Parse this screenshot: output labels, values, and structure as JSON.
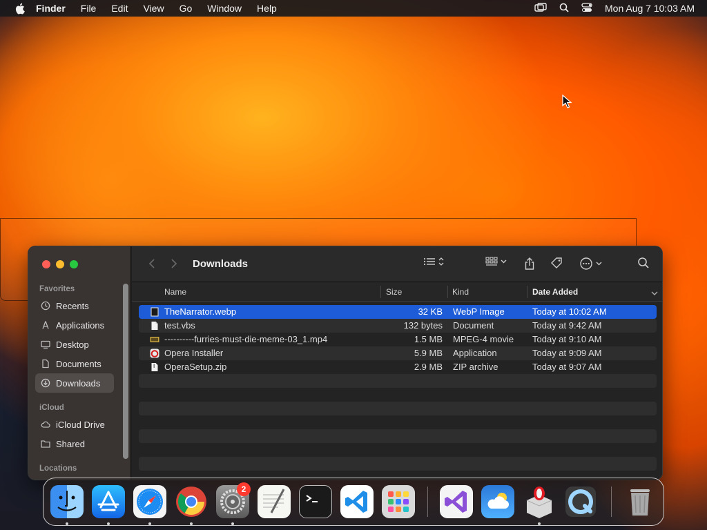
{
  "menubar": {
    "app_name": "Finder",
    "menus": [
      "File",
      "Edit",
      "View",
      "Go",
      "Window",
      "Help"
    ],
    "clock": "Mon Aug 7  10:03 AM",
    "status_icons": [
      "screen-mirroring-icon",
      "spotlight-search-icon",
      "control-center-icon"
    ]
  },
  "finder": {
    "title": "Downloads",
    "sidebar": {
      "favorites_label": "Favorites",
      "favorites": [
        "Recents",
        "Applications",
        "Desktop",
        "Documents",
        "Downloads"
      ],
      "icloud_label": "iCloud",
      "icloud": [
        "iCloud Drive",
        "Shared"
      ],
      "locations_label": "Locations"
    },
    "columns": {
      "name": "Name",
      "size": "Size",
      "kind": "Kind",
      "date_added": "Date Added"
    },
    "files": [
      {
        "name": "TheNarrator.webp",
        "size": "32 KB",
        "kind": "WebP Image",
        "date": "Today at 10:02 AM"
      },
      {
        "name": "test.vbs",
        "size": "132 bytes",
        "kind": "Document",
        "date": "Today at 9:42 AM"
      },
      {
        "name": "----------furries-must-die-meme-03_1.mp4",
        "size": "1.5 MB",
        "kind": "MPEG-4 movie",
        "date": "Today at 9:10 AM"
      },
      {
        "name": "Opera Installer",
        "size": "5.9 MB",
        "kind": "Application",
        "date": "Today at 9:09 AM"
      },
      {
        "name": "OperaSetup.zip",
        "size": "2.9 MB",
        "kind": "ZIP archive",
        "date": "Today at 9:07 AM"
      }
    ]
  },
  "dock": {
    "apps": [
      "Finder",
      "App Store",
      "Safari",
      "Google Chrome",
      "System Settings",
      "TextEdit",
      "Terminal",
      "Visual Studio Code",
      "Launchpad",
      "Visual Studio",
      "Weather",
      "Opera Installer",
      "QuickTime Player",
      "Trash"
    ],
    "settings_badge": "2"
  },
  "colors": {
    "selection": "#1d5cd6",
    "close": "#ff5f57",
    "minimize": "#febc2e",
    "maximize": "#28c840"
  }
}
